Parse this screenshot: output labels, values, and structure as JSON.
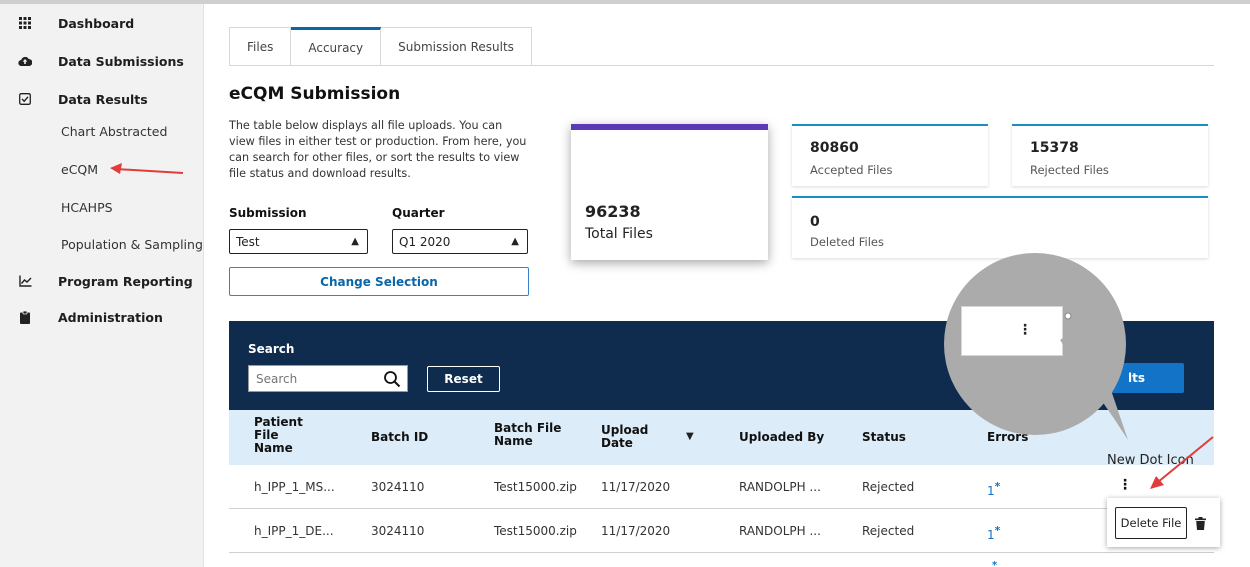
{
  "sidebar": {
    "items": [
      {
        "label": "Dashboard",
        "icon": "grid-icon"
      },
      {
        "label": "Data Submissions",
        "icon": "cloud-upload-icon"
      },
      {
        "label": "Data Results",
        "icon": "checkbox-icon"
      },
      {
        "label": "Program Reporting",
        "icon": "line-chart-icon"
      },
      {
        "label": "Administration",
        "icon": "clipboard-icon"
      }
    ],
    "sub_items": [
      "Chart Abstracted",
      "eCQM",
      "HCAHPS",
      "Population & Sampling"
    ]
  },
  "tabs": [
    {
      "label": "Files",
      "active": false
    },
    {
      "label": "Accuracy",
      "active": true
    },
    {
      "label": "Submission Results",
      "active": false
    }
  ],
  "page": {
    "title": "eCQM Submission",
    "description": "The table below displays all file uploads. You can view files in either test or production. From here, you can search for other files, or sort the results to view file status and download results."
  },
  "filters": {
    "submission_label": "Submission",
    "submission_value": "Test",
    "quarter_label": "Quarter",
    "quarter_value": "Q1 2020",
    "change_button": "Change Selection"
  },
  "stats": {
    "total": {
      "value": "96238",
      "label": "Total Files"
    },
    "accepted": {
      "value": "80860",
      "label": "Accepted Files"
    },
    "rejected": {
      "value": "15378",
      "label": "Rejected Files"
    },
    "deleted": {
      "value": "0",
      "label": "Deleted Files"
    }
  },
  "search": {
    "label": "Search",
    "placeholder": "Search",
    "reset_button": "Reset",
    "results_button": "lts"
  },
  "table": {
    "headers": [
      "Patient File Name",
      "Batch ID",
      "Batch File Name",
      "Upload Date",
      "Uploaded By",
      "Status",
      "Errors"
    ],
    "rows": [
      {
        "file": "h_IPP_1_MS...",
        "batch_id": "3024110",
        "batch_file": "Test15000.zip",
        "date": "11/17/2020",
        "by": "RANDOLPH ...",
        "status": "Rejected",
        "errors": "1"
      },
      {
        "file": "h_IPP_1_DE...",
        "batch_id": "3024110",
        "batch_file": "Test15000.zip",
        "date": "11/17/2020",
        "by": "RANDOLPH ...",
        "status": "Rejected",
        "errors": "1"
      }
    ]
  },
  "annotation": {
    "text": "New Dot Icon"
  },
  "popup": {
    "delete_label": "Delete File"
  },
  "colors": {
    "accent_blue": "#1374c7",
    "navy": "#0f2b4e",
    "purple": "#5b3bb5",
    "annotation_red": "#e23b3b"
  }
}
